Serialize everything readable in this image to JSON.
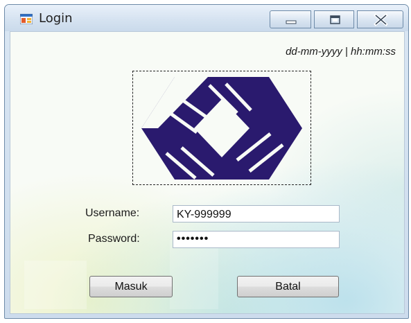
{
  "window": {
    "title": "Login",
    "icon": "form-icon",
    "controls": [
      "minimize-icon",
      "maximize-icon",
      "close-icon"
    ]
  },
  "header": {
    "datetime": "dd-mm-yyyy | hh:mm:ss"
  },
  "logo": {
    "icon": "company-logo",
    "color": "#2a1a6e"
  },
  "form": {
    "username_label": "Username:",
    "username_value": "KY-999999",
    "password_label": "Password:",
    "password_value": "•••••••"
  },
  "buttons": {
    "login_label": "Masuk",
    "cancel_label": "Batal"
  }
}
